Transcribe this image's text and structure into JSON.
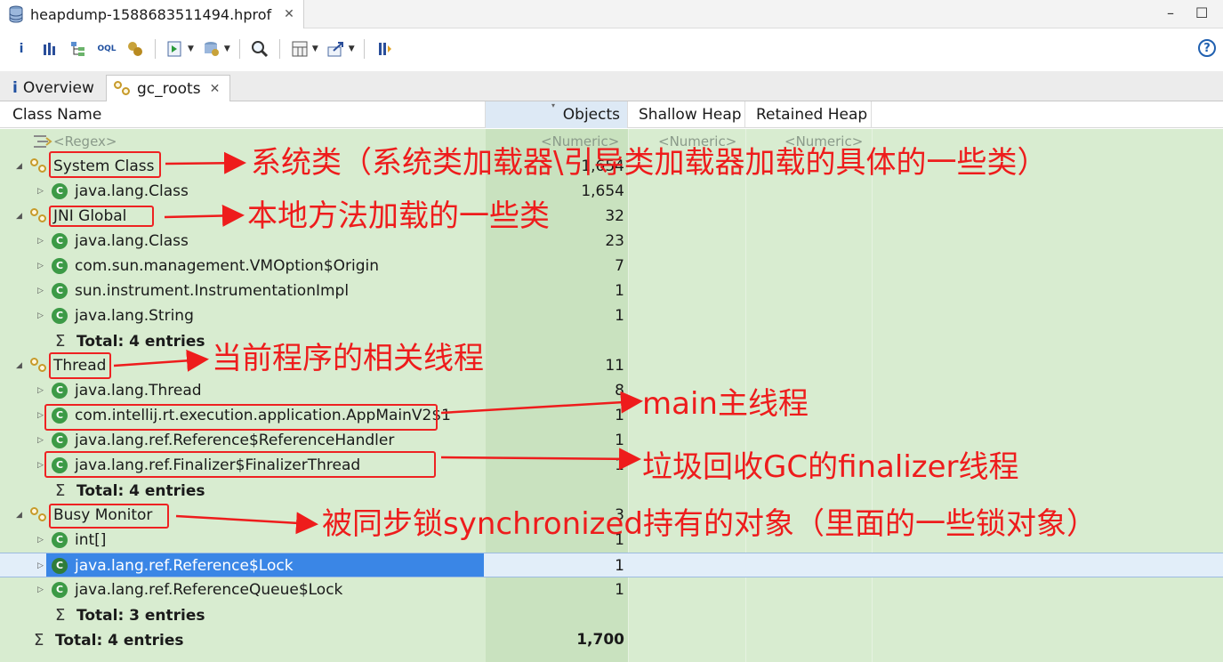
{
  "window": {
    "file_tab": "heapdump-1588683511494.hprof",
    "minimize_symbol": "–",
    "maximize_symbol": "☐"
  },
  "toolbar": {
    "icons": [
      "info-icon",
      "histogram-icon",
      "dominator-tree-icon",
      "oql-icon",
      "thread-overview-icon",
      "run-report-icon",
      "query-browser-icon",
      "search-icon",
      "calculator-icon",
      "export-icon",
      "pin-icon"
    ],
    "help_label": "?"
  },
  "tabs": [
    {
      "label": "Overview",
      "icon": "i"
    },
    {
      "label": "gc_roots"
    }
  ],
  "columns": {
    "class_name": "Class Name",
    "objects": "Objects",
    "shallow_heap": "Shallow Heap",
    "retained_heap": "Retained Heap"
  },
  "filter_row": {
    "regex": "<Regex>",
    "numeric": "<Numeric>"
  },
  "rows": [
    {
      "label": "System Class",
      "objects": "1,654"
    },
    {
      "label": "java.lang.Class",
      "objects": "1,654"
    },
    {
      "label": "JNI Global",
      "objects": "32"
    },
    {
      "label": "java.lang.Class",
      "objects": "23"
    },
    {
      "label": "com.sun.management.VMOption$Origin",
      "objects": "7"
    },
    {
      "label": "sun.instrument.InstrumentationImpl",
      "objects": "1"
    },
    {
      "label": "java.lang.String",
      "objects": "1"
    },
    {
      "label": "Total: 4 entries",
      "objects": ""
    },
    {
      "label": "Thread",
      "objects": "11"
    },
    {
      "label": "java.lang.Thread",
      "objects": "8"
    },
    {
      "label": "com.intellij.rt.execution.application.AppMainV2$1",
      "objects": "1"
    },
    {
      "label": "java.lang.ref.Reference$ReferenceHandler",
      "objects": "1"
    },
    {
      "label": "java.lang.ref.Finalizer$FinalizerThread",
      "objects": "1"
    },
    {
      "label": "Total: 4 entries",
      "objects": ""
    },
    {
      "label": "Busy Monitor",
      "objects": "3"
    },
    {
      "label": "int[]",
      "objects": "1"
    },
    {
      "label": "java.lang.ref.Reference$Lock",
      "objects": "1"
    },
    {
      "label": "java.lang.ref.ReferenceQueue$Lock",
      "objects": "1"
    },
    {
      "label": "Total: 3 entries",
      "objects": ""
    },
    {
      "label": "Total: 4 entries",
      "objects": "1,700"
    }
  ],
  "annotations": {
    "system_class": "系统类（系统类加载器\\引导类加载器加载的具体的一些类）",
    "jni_global": "本地方法加载的一些类",
    "thread": "当前程序的相关线程",
    "main_thread": "main主线程",
    "finalizer": "垃圾回收GC的finalizer线程",
    "busy_monitor": "被同步锁synchronized持有的对象（里面的一些锁对象）"
  },
  "colors": {
    "annotation": "#ee1c1c",
    "grid_background": "#d8ecd0",
    "objects_column": "#c9e2bf",
    "selection": "#3a86e6",
    "class_icon": "#3c9a46"
  }
}
